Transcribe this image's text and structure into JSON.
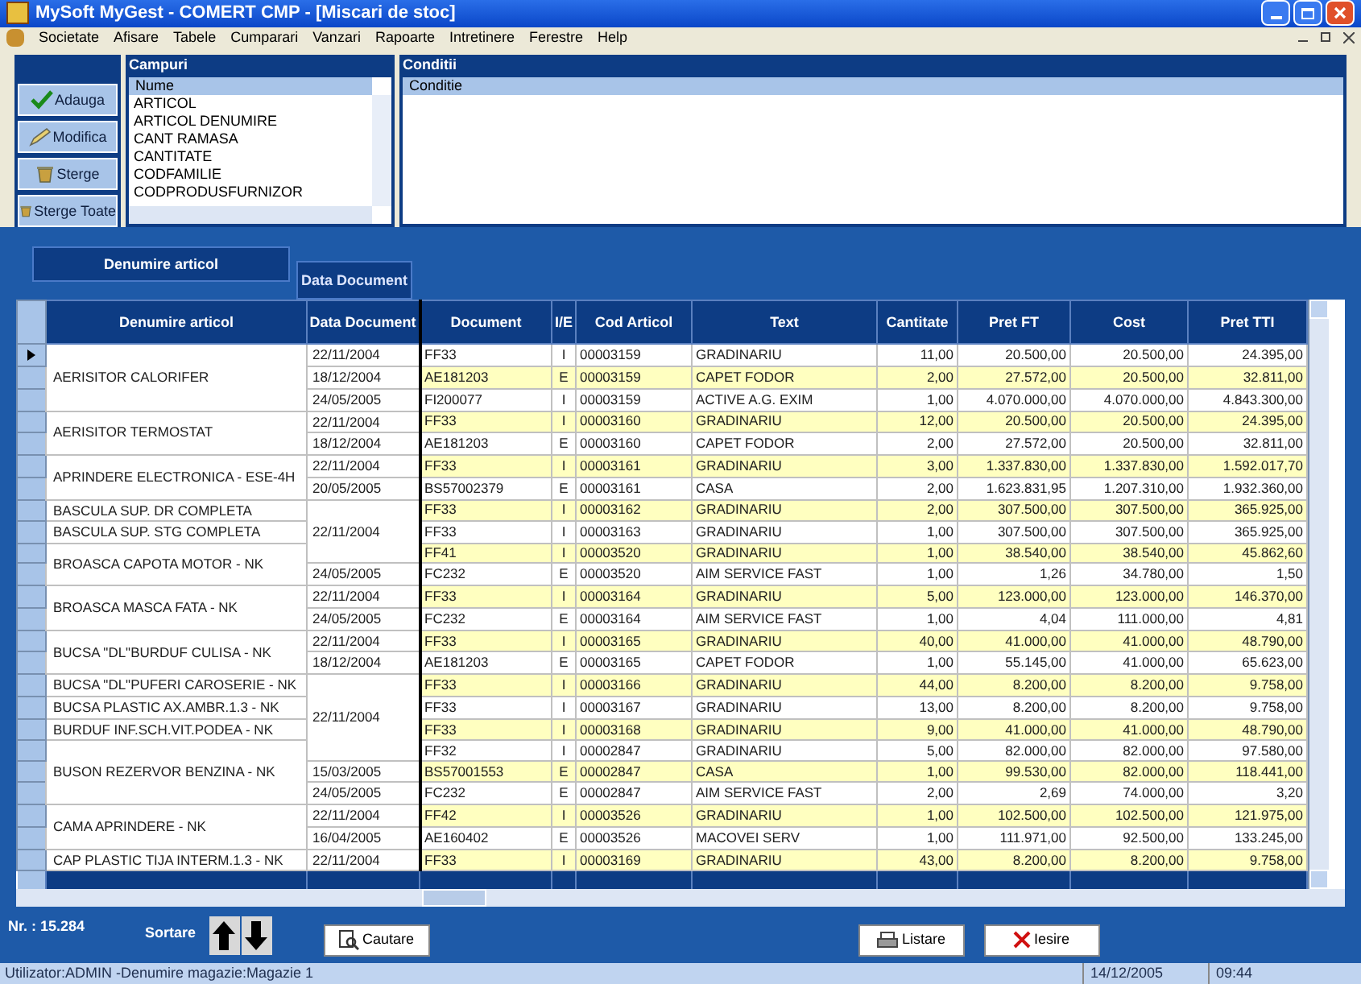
{
  "window": {
    "title": "MySoft MyGest  - COMERT CMP - [Miscari de stoc]"
  },
  "menu": [
    "Societate",
    "Afisare",
    "Tabele",
    "Cumparari",
    "Vanzari",
    "Rapoarte",
    "Intretinere",
    "Ferestre",
    "Help"
  ],
  "actions": [
    {
      "kind": "add",
      "label": "Adauga"
    },
    {
      "kind": "edit",
      "label": "Modifica"
    },
    {
      "kind": "delete",
      "label": "Sterge"
    },
    {
      "kind": "delete_all",
      "label": "Sterge Toate"
    }
  ],
  "fields_panel": {
    "title": "Campuri",
    "column": "Nume",
    "items": [
      "ARTICOL",
      "ARTICOL DENUMIRE",
      "CANT RAMASA",
      "CANTITATE",
      "CODFAMILIE",
      "CODPRODUSFURNIZOR"
    ]
  },
  "conditions_panel": {
    "title": "Conditii",
    "column": "Conditie"
  },
  "sort_tabs": [
    {
      "label": "Denumire articol",
      "selected": true
    },
    {
      "label": "Data Document",
      "selected": false
    }
  ],
  "table": {
    "columns": [
      "Denumire articol",
      "Data Document",
      "Document",
      "I/E",
      "Cod Articol",
      "Text",
      "Cantitate",
      "Pret FT",
      "Cost",
      "Pret TTI"
    ],
    "rows": [
      {
        "selected": true,
        "article": "AERISITOR CALORIFER",
        "date": "22/11/2004",
        "document": "FF33",
        "ie": "I",
        "code": "00003159",
        "text": "GRADINARIU",
        "qty": "11,00",
        "price": "20.500,00",
        "cost": "20.500,00",
        "price_tti": "24.395,00"
      },
      {
        "selected": false,
        "date": "18/12/2004",
        "document": "AE181203",
        "ie": "E",
        "code": "00003159",
        "text": "CAPET FODOR",
        "qty": "2,00",
        "price": "27.572,00",
        "cost": "20.500,00",
        "price_tti": "32.811,00"
      },
      {
        "selected": false,
        "date": "24/05/2005",
        "document": "FI200077",
        "ie": "I",
        "code": "00003159",
        "text": "ACTIVE A.G. EXIM",
        "qty": "1,00",
        "price": "4.070.000,00",
        "cost": "4.070.000,00",
        "price_tti": "4.843.300,00"
      },
      {
        "selected": false,
        "article": "AERISITOR TERMOSTAT",
        "date": "22/11/2004",
        "document": "FF33",
        "ie": "I",
        "code": "00003160",
        "text": "GRADINARIU",
        "qty": "12,00",
        "price": "20.500,00",
        "cost": "20.500,00",
        "price_tti": "24.395,00"
      },
      {
        "selected": false,
        "date": "18/12/2004",
        "document": "AE181203",
        "ie": "E",
        "code": "00003160",
        "text": "CAPET FODOR",
        "qty": "2,00",
        "price": "27.572,00",
        "cost": "20.500,00",
        "price_tti": "32.811,00"
      },
      {
        "selected": false,
        "article": "APRINDERE ELECTRONICA - ESE-4H",
        "date": "22/11/2004",
        "document": "FF33",
        "ie": "I",
        "code": "00003161",
        "text": "GRADINARIU",
        "qty": "3,00",
        "price": "1.337.830,00",
        "cost": "1.337.830,00",
        "price_tti": "1.592.017,70"
      },
      {
        "selected": false,
        "date": "20/05/2005",
        "document": "BS57002379",
        "ie": "E",
        "code": "00003161",
        "text": "CASA",
        "qty": "2,00",
        "price": "1.623.831,95",
        "cost": "1.207.310,00",
        "price_tti": "1.932.360,00"
      },
      {
        "selected": false,
        "article": "BASCULA SUP. DR COMPLETA",
        "date": "22/11/2004",
        "document": "FF33",
        "ie": "I",
        "code": "00003162",
        "text": "GRADINARIU",
        "qty": "2,00",
        "price": "307.500,00",
        "cost": "307.500,00",
        "price_tti": "365.925,00"
      },
      {
        "selected": false,
        "article": "BASCULA SUP. STG COMPLETA",
        "document": "FF33",
        "ie": "I",
        "code": "00003163",
        "text": "GRADINARIU",
        "qty": "1,00",
        "price": "307.500,00",
        "cost": "307.500,00",
        "price_tti": "365.925,00"
      },
      {
        "selected": false,
        "article": "BROASCA CAPOTA MOTOR - NK",
        "document": "FF41",
        "ie": "I",
        "code": "00003520",
        "text": "GRADINARIU",
        "qty": "1,00",
        "price": "38.540,00",
        "cost": "38.540,00",
        "price_tti": "45.862,60"
      },
      {
        "selected": false,
        "date": "24/05/2005",
        "document": "FC232",
        "ie": "E",
        "code": "00003520",
        "text": "AIM SERVICE FAST",
        "qty": "1,00",
        "price": "1,26",
        "cost": "34.780,00",
        "price_tti": "1,50"
      },
      {
        "selected": false,
        "article": "BROASCA MASCA FATA - NK",
        "date": "22/11/2004",
        "document": "FF33",
        "ie": "I",
        "code": "00003164",
        "text": "GRADINARIU",
        "qty": "5,00",
        "price": "123.000,00",
        "cost": "123.000,00",
        "price_tti": "146.370,00"
      },
      {
        "selected": false,
        "date": "24/05/2005",
        "document": "FC232",
        "ie": "E",
        "code": "00003164",
        "text": "AIM SERVICE FAST",
        "qty": "1,00",
        "price": "4,04",
        "cost": "111.000,00",
        "price_tti": "4,81"
      },
      {
        "selected": false,
        "article": "BUCSA \"DL\"BURDUF CULISA - NK",
        "date": "22/11/2004",
        "document": "FF33",
        "ie": "I",
        "code": "00003165",
        "text": "GRADINARIU",
        "qty": "40,00",
        "price": "41.000,00",
        "cost": "41.000,00",
        "price_tti": "48.790,00"
      },
      {
        "selected": false,
        "date": "18/12/2004",
        "document": "AE181203",
        "ie": "E",
        "code": "00003165",
        "text": "CAPET FODOR",
        "qty": "1,00",
        "price": "55.145,00",
        "cost": "41.000,00",
        "price_tti": "65.623,00"
      },
      {
        "selected": false,
        "article": "BUCSA \"DL\"PUFERI CAROSERIE - NK",
        "date": "22/11/2004",
        "document": "FF33",
        "ie": "I",
        "code": "00003166",
        "text": "GRADINARIU",
        "qty": "44,00",
        "price": "8.200,00",
        "cost": "8.200,00",
        "price_tti": "9.758,00"
      },
      {
        "selected": false,
        "article": "BUCSA PLASTIC AX.AMBR.1.3 - NK",
        "document": "FF33",
        "ie": "I",
        "code": "00003167",
        "text": "GRADINARIU",
        "qty": "13,00",
        "price": "8.200,00",
        "cost": "8.200,00",
        "price_tti": "9.758,00"
      },
      {
        "selected": false,
        "article": "BURDUF INF.SCH.VIT.PODEA - NK",
        "document": "FF33",
        "ie": "I",
        "code": "00003168",
        "text": "GRADINARIU",
        "qty": "9,00",
        "price": "41.000,00",
        "cost": "41.000,00",
        "price_tti": "48.790,00"
      },
      {
        "selected": false,
        "article": "BUSON REZERVOR BENZINA - NK",
        "document": "FF32",
        "ie": "I",
        "code": "00002847",
        "text": "GRADINARIU",
        "qty": "5,00",
        "price": "82.000,00",
        "cost": "82.000,00",
        "price_tti": "97.580,00"
      },
      {
        "selected": false,
        "date": "15/03/2005",
        "document": "BS57001553",
        "ie": "E",
        "code": "00002847",
        "text": "CASA",
        "qty": "1,00",
        "price": "99.530,00",
        "cost": "82.000,00",
        "price_tti": "118.441,00"
      },
      {
        "selected": false,
        "date": "24/05/2005",
        "document": "FC232",
        "ie": "E",
        "code": "00002847",
        "text": "AIM SERVICE FAST",
        "qty": "2,00",
        "price": "2,69",
        "cost": "74.000,00",
        "price_tti": "3,20"
      },
      {
        "selected": false,
        "article": "CAMA APRINDERE - NK",
        "date": "22/11/2004",
        "document": "FF42",
        "ie": "I",
        "code": "00003526",
        "text": "GRADINARIU",
        "qty": "1,00",
        "price": "102.500,00",
        "cost": "102.500,00",
        "price_tti": "121.975,00"
      },
      {
        "selected": false,
        "date": "16/04/2005",
        "document": "AE160402",
        "ie": "E",
        "code": "00003526",
        "text": "MACOVEI SERV",
        "qty": "1,00",
        "price": "111.971,00",
        "cost": "92.500,00",
        "price_tti": "133.245,00"
      },
      {
        "selected": false,
        "article": "CAP PLASTIC TIJA INTERM.1.3 - NK",
        "date": "22/11/2004",
        "document": "FF33",
        "ie": "I",
        "code": "00003169",
        "text": "GRADINARIU",
        "qty": "43,00",
        "price": "8.200,00",
        "cost": "8.200,00",
        "price_tti": "9.758,00"
      }
    ]
  },
  "record_count": "Nr. : 15.284",
  "sort_label": "Sortare",
  "bottom_buttons": [
    {
      "kind": "search",
      "label": "Cautare"
    },
    {
      "kind": "print",
      "label": "Listare"
    },
    {
      "kind": "exit",
      "label": "Iesire"
    }
  ],
  "status_bar": {
    "user": "Utilizator:ADMIN -Denumire magazie:Magazie 1",
    "date": "14/12/2005",
    "time": "09:44"
  }
}
